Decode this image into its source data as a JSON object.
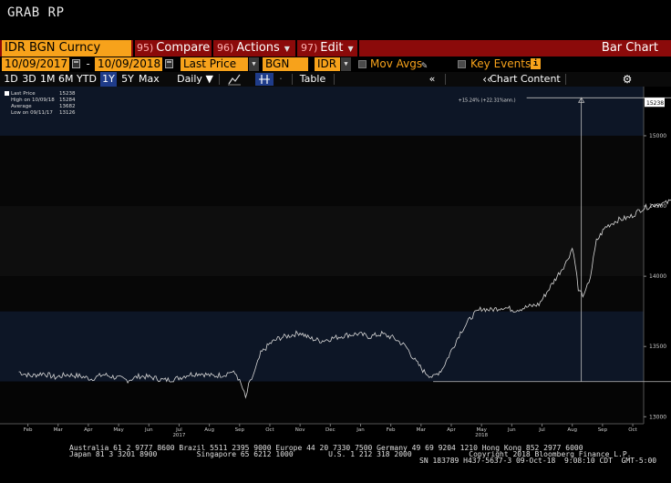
{
  "window": {
    "title": "GRAB RP"
  },
  "command_bar": {
    "security": "IDR BGN Curncy",
    "compare": {
      "num": "95)",
      "label": "Compare"
    },
    "actions": {
      "num": "96)",
      "label": "Actions"
    },
    "edit": {
      "num": "97)",
      "label": "Edit"
    },
    "chart_type": "Bar Chart"
  },
  "params": {
    "start_date": "10/09/2017",
    "end_date": "10/09/2018",
    "field": "Last Price",
    "source": "BGN",
    "currency": "IDR",
    "mov_avgs": "Mov Avgs",
    "key_events": "Key Events"
  },
  "toolbar": {
    "periods": [
      "1D",
      "3D",
      "1M",
      "6M",
      "YTD",
      "1Y",
      "5Y",
      "Max"
    ],
    "active_period": "1Y",
    "frequency": "Daily",
    "table": "Table",
    "chart_content": "Chart Content"
  },
  "legend": {
    "last_price_label": "Last Price",
    "last_price": "15238",
    "high_label": "High on 10/09/18",
    "high": "15284",
    "average_label": "Average",
    "average": "13682",
    "low_label": "Low on 09/11/17",
    "low": "13126"
  },
  "chart_data": {
    "type": "line",
    "title": "",
    "xlabel": "",
    "ylabel": "",
    "ylim": [
      12950,
      15350
    ],
    "y_ticks": [
      13000,
      13500,
      14000,
      14500,
      15000
    ],
    "last_value_label": "15238",
    "annotation": "+15.24% (+22.31%ann.)",
    "x_tick_labels": [
      "Feb",
      "Mar",
      "Apr",
      "May",
      "Jun",
      "Jul",
      "Aug",
      "Sep",
      "Oct",
      "Nov",
      "Dec",
      "Jan",
      "Feb",
      "Mar",
      "Apr",
      "May",
      "Jun",
      "Jul",
      "Aug",
      "Sep",
      "Oct"
    ],
    "x_year_labels": [
      {
        "label": "2017",
        "month_index": 5
      },
      {
        "label": "2018",
        "month_index": 15
      }
    ],
    "x_start_month_offset": -0.2,
    "series": [
      {
        "values_by_month": [
          [
            0,
            13320
          ],
          [
            0.4,
            13290
          ],
          [
            0.8,
            13310
          ],
          [
            1.2,
            13280
          ],
          [
            1.6,
            13300
          ],
          [
            2.0,
            13290
          ],
          [
            2.4,
            13270
          ],
          [
            2.8,
            13300
          ],
          [
            3.2,
            13280
          ],
          [
            3.6,
            13260
          ],
          [
            4.0,
            13290
          ],
          [
            4.4,
            13280
          ],
          [
            4.8,
            13260
          ],
          [
            5.2,
            13270
          ],
          [
            5.6,
            13300
          ],
          [
            6.0,
            13310
          ],
          [
            6.4,
            13290
          ],
          [
            6.8,
            13300
          ],
          [
            7.0,
            13320
          ],
          [
            7.2,
            13300
          ],
          [
            7.4,
            13200
          ],
          [
            7.5,
            13130
          ],
          [
            7.6,
            13220
          ],
          [
            7.8,
            13320
          ],
          [
            8.0,
            13450
          ],
          [
            8.3,
            13520
          ],
          [
            8.6,
            13560
          ],
          [
            9.0,
            13580
          ],
          [
            9.3,
            13600
          ],
          [
            9.6,
            13560
          ],
          [
            10.0,
            13540
          ],
          [
            10.4,
            13560
          ],
          [
            10.8,
            13580
          ],
          [
            11.2,
            13590
          ],
          [
            11.6,
            13570
          ],
          [
            12.0,
            13590
          ],
          [
            12.4,
            13560
          ],
          [
            12.8,
            13500
          ],
          [
            13.1,
            13400
          ],
          [
            13.4,
            13320
          ],
          [
            13.7,
            13280
          ],
          [
            14.0,
            13340
          ],
          [
            14.3,
            13470
          ],
          [
            14.6,
            13600
          ],
          [
            15.0,
            13720
          ],
          [
            15.3,
            13770
          ],
          [
            15.6,
            13760
          ],
          [
            16.0,
            13780
          ],
          [
            16.4,
            13760
          ],
          [
            16.8,
            13780
          ],
          [
            17.2,
            13800
          ],
          [
            17.5,
            13900
          ],
          [
            17.8,
            14000
          ],
          [
            18.1,
            14100
          ],
          [
            18.3,
            14200
          ],
          [
            18.4,
            14100
          ],
          [
            18.5,
            13900
          ],
          [
            18.7,
            13860
          ],
          [
            18.9,
            14000
          ],
          [
            19.1,
            14250
          ],
          [
            19.4,
            14350
          ],
          [
            19.8,
            14400
          ],
          [
            20.2,
            14420
          ],
          [
            20.6,
            14480
          ],
          [
            21.0,
            14510
          ],
          [
            21.4,
            14520
          ],
          [
            21.8,
            14560
          ],
          [
            22.2,
            14660
          ],
          [
            22.6,
            14720
          ],
          [
            23.0,
            14800
          ],
          [
            23.3,
            14880
          ],
          [
            23.6,
            14860
          ],
          [
            23.9,
            14900
          ],
          [
            24.2,
            14950
          ],
          [
            24.5,
            15000
          ],
          [
            24.8,
            15100
          ],
          [
            25.0,
            15200
          ],
          [
            25.1,
            15238
          ]
        ]
      }
    ]
  },
  "footer": {
    "line1": "Australia 61 2 9777 8600 Brazil 5511 2395 9000 Europe 44 20 7330 7500 Germany 49 69 9204 1210 Hong Kong 852 2977 6000",
    "line2": "Japan 81 3 3201 8900         Singapore 65 6212 1000        U.S. 1 212 318 2000             Copyright 2018 Bloomberg Finance L.P.",
    "line3": "SN 183789 H437-5637-3 09-Oct-18  9:08:10 CDT  GMT-5:00"
  },
  "colors": {
    "orange": "#f7a21b",
    "command_red": "#8b0a0a",
    "active_blue": "#1f3c8a",
    "band_blue": "#0d1626"
  },
  "icons": [
    "calendar-icon",
    "dropdown-arrow-icon",
    "pencil-icon",
    "info-icon",
    "line-chart-icon",
    "crosshair-icon",
    "collapse-icon",
    "gear-icon"
  ]
}
